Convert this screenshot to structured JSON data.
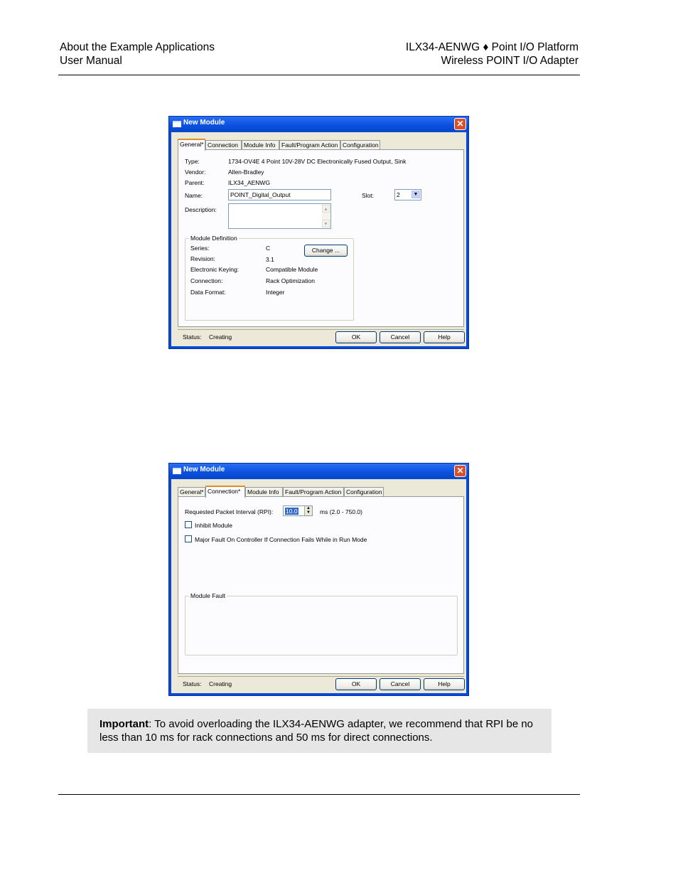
{
  "header": {
    "left_line1": "About the Example Applications",
    "left_line2": "User Manual",
    "right_line1": "ILX34-AENWG ♦ Point I/O Platform",
    "right_line2": "Wireless POINT I/O Adapter"
  },
  "dialog1": {
    "title": "New Module",
    "tabs": [
      "General*",
      "Connection",
      "Module Info",
      "Fault/Program Action",
      "Configuration"
    ],
    "type_label": "Type:",
    "type_value": "1734-OV4E 4 Point 10V-28V DC Electronically Fused Output, Sink",
    "vendor_label": "Vendor:",
    "vendor_value": "Allen-Bradley",
    "parent_label": "Parent:",
    "parent_value": "ILX34_AENWG",
    "name_label": "Name:",
    "name_value": "POINT_Digital_Output",
    "slot_label": "Slot:",
    "slot_value": "2",
    "description_label": "Description:",
    "module_definition": {
      "title": "Module Definition",
      "series_label": "Series:",
      "series_value": "C",
      "revision_label": "Revision:",
      "revision_value": "3.1",
      "keying_label": "Electronic Keying:",
      "keying_value": "Compatible Module",
      "connection_label": "Connection:",
      "connection_value": "Rack Optimization",
      "format_label": "Data Format:",
      "format_value": "Integer",
      "change_button": "Change ..."
    },
    "status_label": "Status:",
    "status_value": "Creating",
    "ok_button": "OK",
    "cancel_button": "Cancel",
    "help_button": "Help"
  },
  "dialog2": {
    "title": "New Module",
    "tabs": [
      "General*",
      "Connection*",
      "Module Info",
      "Fault/Program Action",
      "Configuration"
    ],
    "rpi_label": "Requested Packet Interval (RPI):",
    "rpi_value": "10.0",
    "rpi_range": "ms (2.0 - 750.0)",
    "inhibit_label": "Inhibit Module",
    "major_fault_label": "Major Fault On Controller If Connection Fails While in Run Mode",
    "module_fault_title": "Module Fault",
    "status_label": "Status:",
    "status_value": "Creating",
    "ok_button": "OK",
    "cancel_button": "Cancel",
    "help_button": "Help"
  },
  "note": {
    "bold": "Important",
    "text": ": To avoid overloading the ILX34-AENWG adapter, we recommend that RPI be no less than 10 ms for rack connections and 50 ms for direct connections."
  }
}
